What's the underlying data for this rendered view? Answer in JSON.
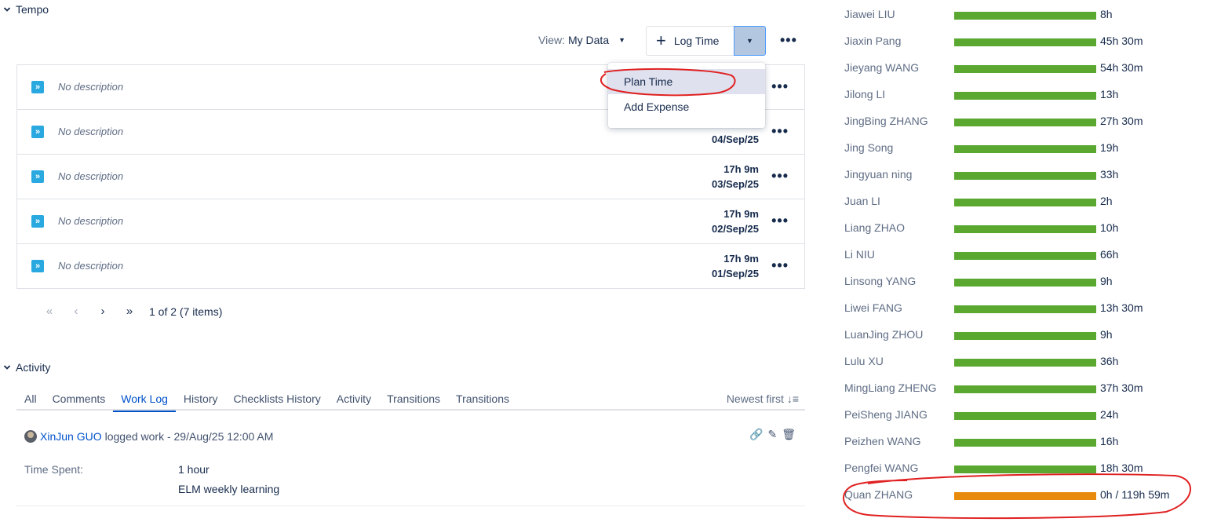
{
  "tempo": {
    "title": "Tempo",
    "view_label": "View:",
    "view_value": "My Data",
    "log_time_label": "Log Time",
    "dropdown": [
      {
        "label": "Plan Time",
        "active": true
      },
      {
        "label": "Add Expense",
        "active": false
      }
    ],
    "worklogs": [
      {
        "description": "No description",
        "duration": "",
        "date": ""
      },
      {
        "description": "No description",
        "duration": "",
        "date": "04/Sep/25"
      },
      {
        "description": "No description",
        "duration": "17h 9m",
        "date": "03/Sep/25"
      },
      {
        "description": "No description",
        "duration": "17h 9m",
        "date": "02/Sep/25"
      },
      {
        "description": "No description",
        "duration": "17h 9m",
        "date": "01/Sep/25"
      }
    ],
    "pagination": "1 of 2 (7 items)"
  },
  "activity": {
    "title": "Activity",
    "tabs": [
      "All",
      "Comments",
      "Work Log",
      "History",
      "Checklists History",
      "Activity",
      "Transitions",
      "Transitions"
    ],
    "active_tab": 2,
    "sort_label": "Newest first",
    "entry": {
      "user": "XinJun GUO",
      "action": "logged work - 29/Aug/25 12:00 AM",
      "time_spent_label": "Time Spent:",
      "time_spent_value": "1 hour",
      "comment": "ELM weekly learning"
    }
  },
  "users": [
    {
      "name": "Jiawei LIU",
      "time": "8h",
      "fill": 1.0,
      "status": "ok"
    },
    {
      "name": "Jiaxin Pang",
      "time": "45h 30m",
      "fill": 1.0,
      "status": "ok"
    },
    {
      "name": "Jieyang WANG",
      "time": "54h 30m",
      "fill": 1.0,
      "status": "ok"
    },
    {
      "name": "Jilong LI",
      "time": "13h",
      "fill": 1.0,
      "status": "ok"
    },
    {
      "name": "JingBing ZHANG",
      "time": "27h 30m",
      "fill": 1.0,
      "status": "ok"
    },
    {
      "name": "Jing Song",
      "time": "19h",
      "fill": 1.0,
      "status": "ok"
    },
    {
      "name": "Jingyuan ning",
      "time": "33h",
      "fill": 1.0,
      "status": "ok"
    },
    {
      "name": "Juan LI",
      "time": "2h",
      "fill": 1.0,
      "status": "ok"
    },
    {
      "name": "Liang ZHAO",
      "time": "10h",
      "fill": 1.0,
      "status": "ok"
    },
    {
      "name": "Li NIU",
      "time": "66h",
      "fill": 1.0,
      "status": "ok"
    },
    {
      "name": "Linsong YANG",
      "time": "9h",
      "fill": 1.0,
      "status": "ok"
    },
    {
      "name": "Liwei FANG",
      "time": "13h 30m",
      "fill": 1.0,
      "status": "ok"
    },
    {
      "name": "LuanJing ZHOU",
      "time": "9h",
      "fill": 1.0,
      "status": "ok"
    },
    {
      "name": "Lulu XU",
      "time": "36h",
      "fill": 1.0,
      "status": "ok"
    },
    {
      "name": "MingLiang ZHENG",
      "time": "37h 30m",
      "fill": 1.0,
      "status": "ok"
    },
    {
      "name": "PeiSheng JIANG",
      "time": "24h",
      "fill": 1.0,
      "status": "ok"
    },
    {
      "name": "Peizhen WANG",
      "time": "16h",
      "fill": 1.0,
      "status": "ok"
    },
    {
      "name": "Pengfei WANG",
      "time": "18h 30m",
      "fill": 1.0,
      "status": "ok"
    },
    {
      "name": "Quan ZHANG",
      "time": "0h / 119h 59m",
      "fill": 1.0,
      "status": "warn"
    }
  ],
  "colors": {
    "bar_ok": "#5aa830",
    "bar_warn": "#e88b0c",
    "annotation": "#e02020",
    "link": "#0052cc"
  }
}
